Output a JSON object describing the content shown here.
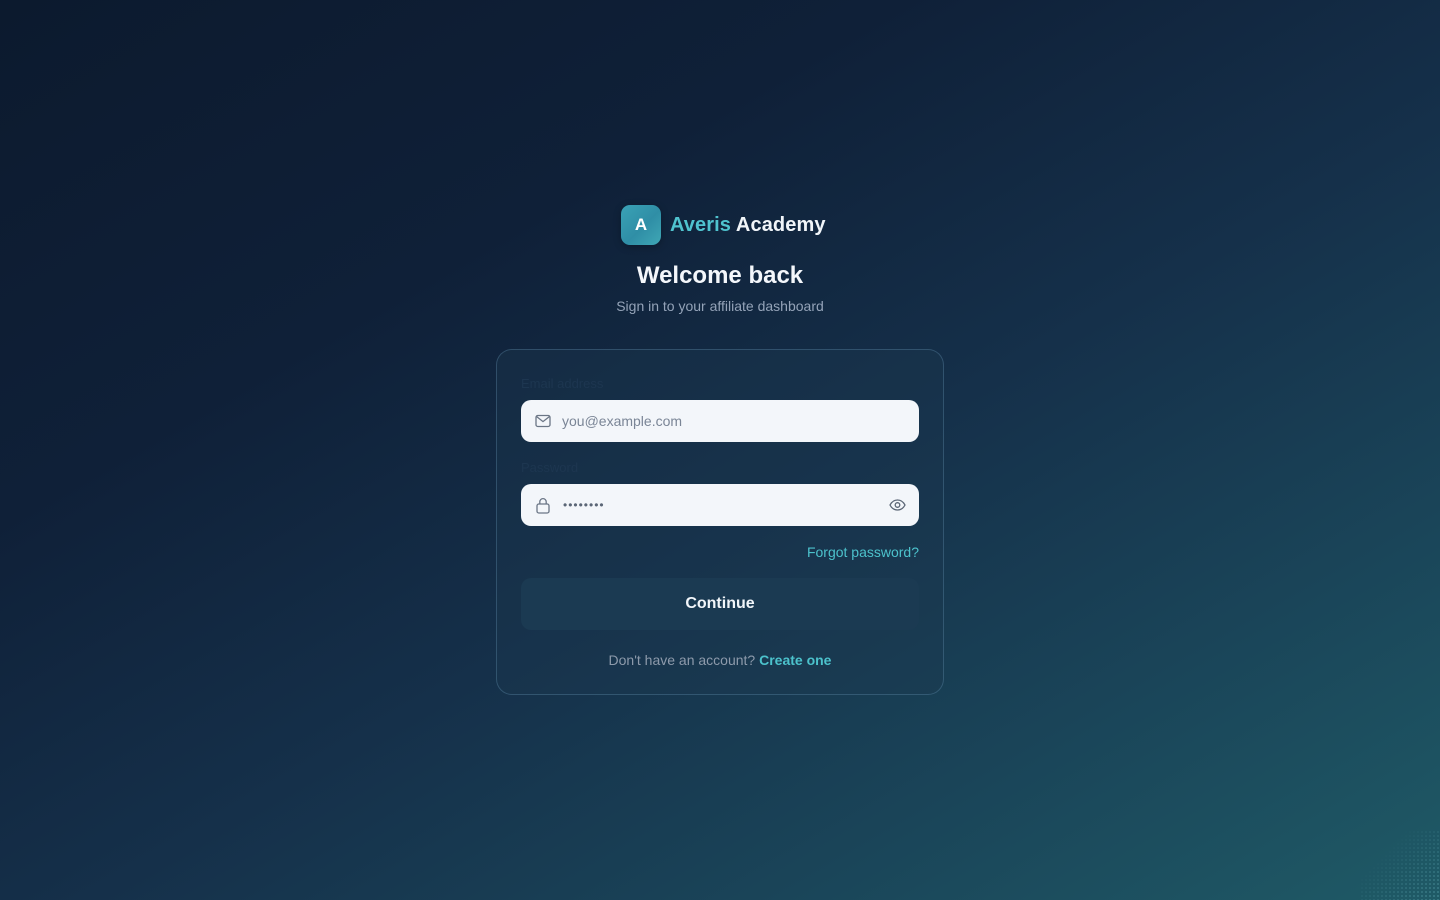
{
  "brand": {
    "logo_letter": "A",
    "name_accent": "Averis",
    "name_rest": " Academy",
    "accent_color": "#4fc3cf"
  },
  "header": {
    "title": "Welcome back",
    "subtitle": "Sign in to your affiliate dashboard"
  },
  "form": {
    "email": {
      "label": "Email address",
      "placeholder": "you@example.com",
      "value": "",
      "icon": "mail-icon"
    },
    "password": {
      "label": "Password",
      "masked_value": "••••••••",
      "icon": "lock-icon",
      "toggle_icon": "eye-icon"
    },
    "forgot_label": "Forgot password?",
    "submit_label": "Continue",
    "signup_prompt": "Don't have an account?",
    "signup_link": "Create one"
  },
  "colors": {
    "link": "#4cc2cc",
    "button_bg": "#1b3a52",
    "input_bg": "#f3f6fa"
  }
}
